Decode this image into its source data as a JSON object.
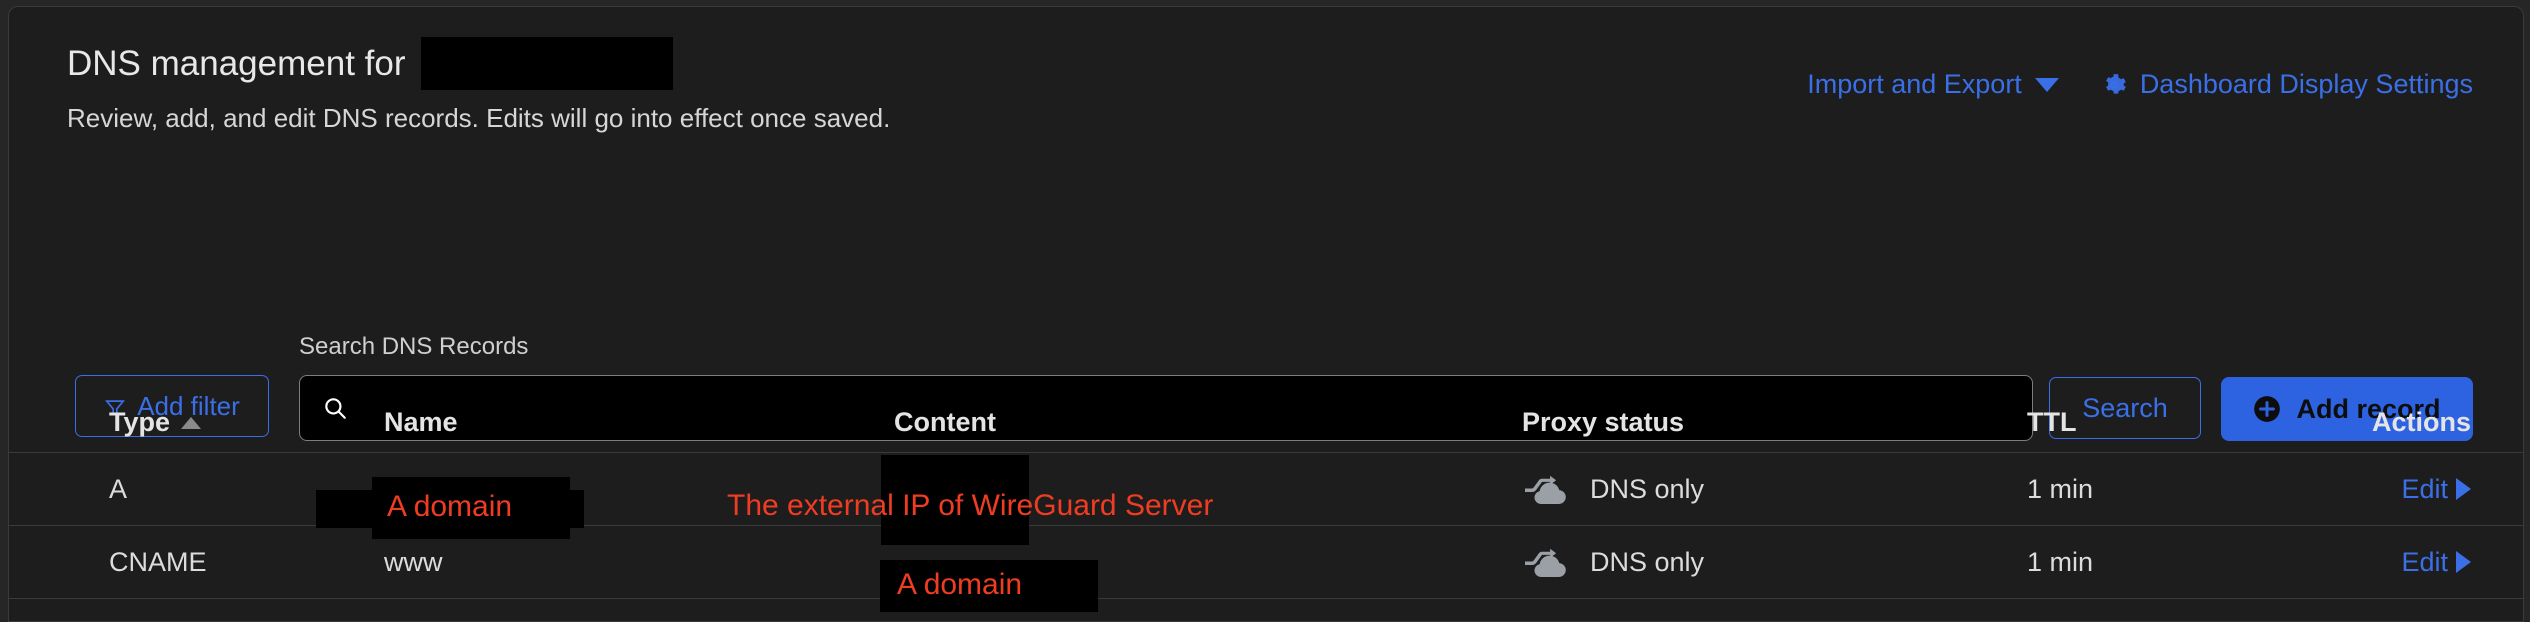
{
  "header": {
    "title": "DNS management for",
    "title_redacted": true,
    "subtitle": "Review, add, and edit DNS records. Edits will go into effect once saved.",
    "links": [
      {
        "label": "Import and Export",
        "icon": "chevron-down-icon"
      },
      {
        "label": "Dashboard Display Settings",
        "icon": "gear-icon"
      }
    ]
  },
  "toolbar": {
    "add_filter_label": "Add filter",
    "add_filter_icon": "filter-funnel-icon",
    "search_label": "Search DNS Records",
    "search_placeholder": "",
    "search_value": "",
    "search_icon": "search-icon",
    "search_button_label": "Search",
    "add_record_label": "Add record",
    "add_record_icon": "plus-circle-icon"
  },
  "table": {
    "columns": [
      {
        "label": "Type",
        "sort": "ascending"
      },
      {
        "label": "Name",
        "sort": ""
      },
      {
        "label": "Content",
        "sort": ""
      },
      {
        "label": "Proxy status",
        "sort": ""
      },
      {
        "label": "TTL",
        "sort": ""
      },
      {
        "label": "Actions",
        "sort": ""
      }
    ],
    "rows": [
      {
        "type": "A",
        "name": "",
        "content": "",
        "proxy_status": "DNS only",
        "proxy_icon": "grey-cloud-arrow-icon",
        "ttl": "1 min",
        "action": "Edit"
      },
      {
        "type": "CNAME",
        "name": "www",
        "content": "",
        "proxy_status": "DNS only",
        "proxy_icon": "grey-cloud-arrow-icon",
        "ttl": "1 min",
        "action": "Edit"
      }
    ]
  },
  "annotations": [
    {
      "text": "A domain",
      "color": "#f03c22"
    },
    {
      "text": "The external IP of WireGuard Server",
      "color": "#f03c22"
    },
    {
      "text": "A domain",
      "color": "#f03c22"
    }
  ],
  "colors": {
    "accent_blue": "#3b6fe8",
    "button_blue": "#2d62e0",
    "annotation_red": "#f03c22",
    "card_bg": "#1d1d1d",
    "page_bg": "#262626",
    "border": "#3a3a3a"
  }
}
